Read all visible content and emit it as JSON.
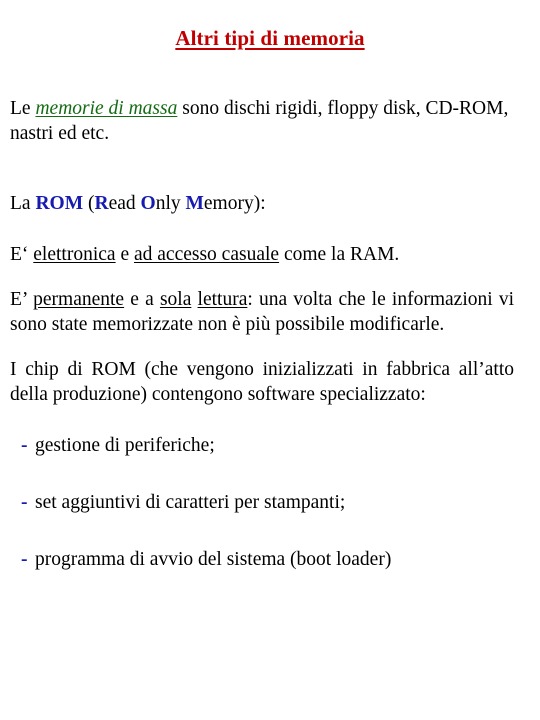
{
  "slide": {
    "title": "Altri tipi di memoria",
    "title_color": "#c00000",
    "background_color": "#ffffff",
    "body_text_color": "#000000",
    "accent_green": "#146b14",
    "accent_blue": "#181bb0"
  },
  "paragraphs": {
    "p1": {
      "lead": "Le ",
      "emphasis": "memorie di massa",
      "rest": " sono dischi rigidi, floppy disk, CD-ROM, nastri ed etc."
    },
    "p2": {
      "lead": "La ",
      "rom": "ROM",
      "open": " (",
      "r": "R",
      "ead": "ead ",
      "o": "O",
      "nly": "nly ",
      "m": "M",
      "emory": "emory):"
    },
    "p3": {
      "lead": "E‘ ",
      "u1": "elettronica",
      "mid": " e ",
      "u2": "ad accesso casuale",
      "rest": " come la RAM."
    },
    "p4": {
      "lead": "E’ ",
      "u1": "permanente",
      "mid": " e a ",
      "u2a": "sola",
      "space": " ",
      "u2b": "lettura",
      "rest": ": una volta che le informazioni vi sono state memorizzate non è più possibile modificarle."
    },
    "p5": {
      "text": "I chip di ROM (che vengono inizializzati in fabbrica all’atto della produzione) contengono software specializzato:"
    }
  },
  "bullets": {
    "marker": "-",
    "items": [
      {
        "text": "gestione di periferiche;"
      },
      {
        "text": "set aggiuntivi di caratteri per stampanti;"
      },
      {
        "text": "programma di avvio del sistema (boot loader)"
      }
    ]
  }
}
